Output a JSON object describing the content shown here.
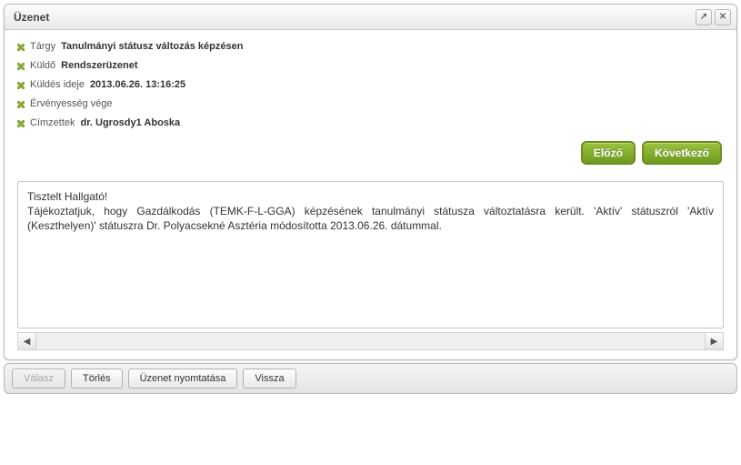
{
  "dialog": {
    "title": "Üzenet"
  },
  "meta": {
    "subject_label": "Tárgy",
    "subject_value": "Tanulmányi státusz változás képzésen",
    "sender_label": "Küldő",
    "sender_value": "Rendszerüzenet",
    "sent_label": "Küldés ideje",
    "sent_value": "2013.06.26. 13:16:25",
    "validity_label": "Érvényesség vége",
    "validity_value": "",
    "recipients_label": "Címzettek",
    "recipients_value": "dr. Ugrosdy1 Aboska"
  },
  "nav": {
    "prev": "Előző",
    "next": "Következő"
  },
  "message": {
    "greeting": "Tisztelt Hallgató!",
    "body": "Tájékoztatjuk, hogy Gazdálkodás (TEMK-F-L-GGA) képzésének tanulmányi státusza változtatásra került. 'Aktív' státuszról 'Aktív (Keszthelyen)' státuszra Dr. Polyacsekné Asztéria módosította 2013.06.26. dátummal."
  },
  "footer": {
    "reply": "Válasz",
    "delete": "Törlés",
    "print": "Üzenet nyomtatása",
    "back": "Vissza"
  }
}
